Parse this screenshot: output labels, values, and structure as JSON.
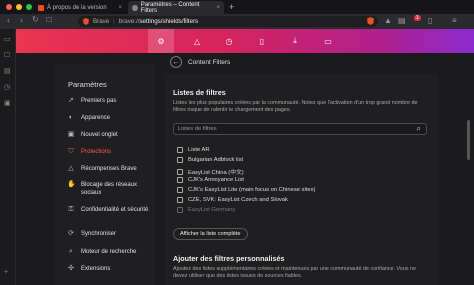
{
  "tabs": [
    {
      "label": "À propos de la version"
    },
    {
      "label": "Paramètres – Content Filters"
    }
  ],
  "new_tab_symbol": "+",
  "close_symbol": "×",
  "toolbar": {
    "brand": "Brave",
    "url_prefix": "brave://",
    "url_path": "settings/shields/filters",
    "notifications": "1"
  },
  "sidebar": {
    "title": "Paramètres",
    "items": [
      {
        "label": "Premiers pas",
        "icon": "rocket-icon"
      },
      {
        "label": "Apparence",
        "icon": "palette-icon"
      },
      {
        "label": "Nouvel onglet",
        "icon": "new-tab-icon"
      },
      {
        "label": "Protections",
        "icon": "shield-icon"
      },
      {
        "label": "Récompenses Brave",
        "icon": "rewards-icon"
      },
      {
        "label": "Blocage des réseaux sociaux",
        "icon": "thumb-down-icon"
      },
      {
        "label": "Confidentialité et sécurité",
        "icon": "lock-icon"
      },
      {
        "label": "Synchroniser",
        "icon": "sync-icon"
      },
      {
        "label": "Moteur de recherche",
        "icon": "search-icon"
      },
      {
        "label": "Extensions",
        "icon": "puzzle-icon"
      }
    ]
  },
  "panel": {
    "title": "Content Filters",
    "section1_title": "Listes de filtres",
    "section1_desc": "Listes les plus populaires créées par la communauté. Notez que l'activation d'un trop grand nombre de filtres risque de ralentir le chargement des pages.",
    "search_placeholder": "Listes de filtres",
    "filters": [
      {
        "label": "Liste AR"
      },
      {
        "label": "Bulgarian Adblock list"
      },
      {
        "label": "EasyList China (中文)"
      },
      {
        "label": "CJK's Annoyance List"
      },
      {
        "label": "CJK's EasyList Lite (main focus on Chinese sites)"
      },
      {
        "label": "CZE, SVK: EasyList Czech and Slovak"
      },
      {
        "label": "EasyList Germany"
      }
    ],
    "show_all_button": "Afficher la liste complète",
    "section2_title": "Ajouter des filtres personnalisés",
    "section2_desc": "Ajoutez des listes supplémentaires créées et maintenues par une communauté de confiance. Vous ne devez utiliser que des listes issues de sources fiables."
  },
  "colors": {
    "accent": "#ff5a4a",
    "header_gradient_start": "#ea3450",
    "header_gradient_end": "#8a2bd0"
  }
}
